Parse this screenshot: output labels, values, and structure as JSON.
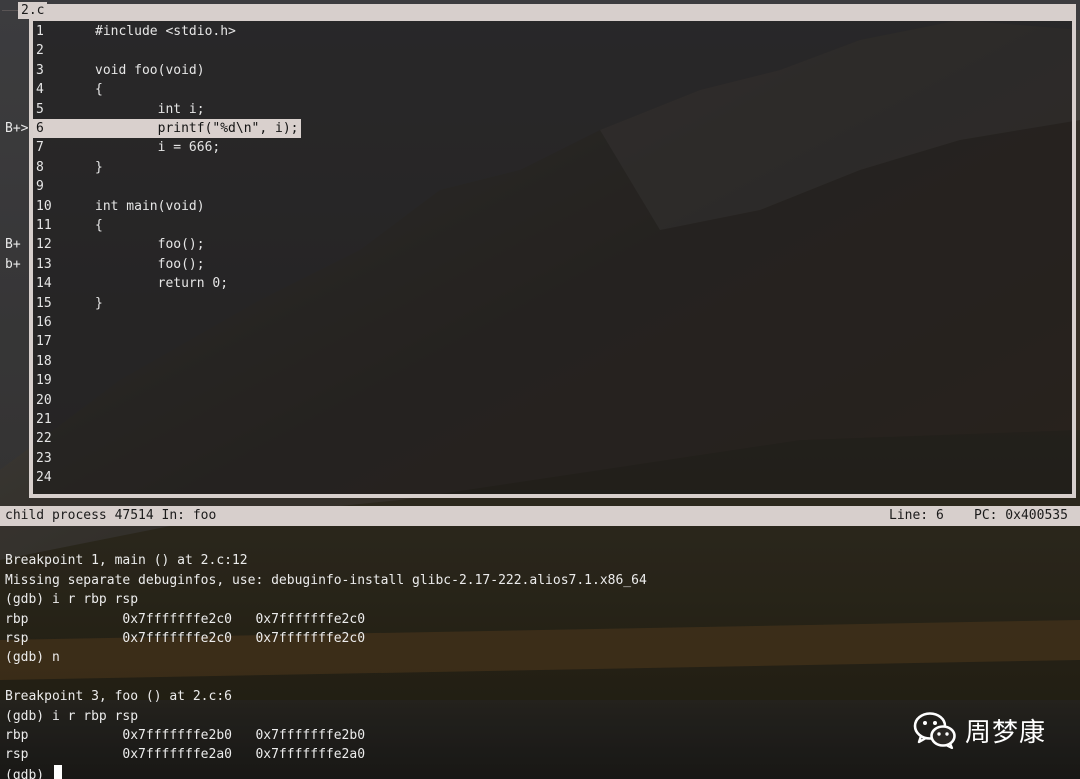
{
  "source_window": {
    "title": "2.c",
    "lines": [
      {
        "num": "1",
        "code": "#include <stdio.h>"
      },
      {
        "num": "2",
        "code": ""
      },
      {
        "num": "3",
        "code": "void foo(void)"
      },
      {
        "num": "4",
        "code": "{"
      },
      {
        "num": "5",
        "code": "        int i;"
      },
      {
        "num": "6",
        "code": "        printf(\"%d\\n\", i);"
      },
      {
        "num": "7",
        "code": "        i = 666;"
      },
      {
        "num": "8",
        "code": "}"
      },
      {
        "num": "9",
        "code": ""
      },
      {
        "num": "10",
        "code": "int main(void)"
      },
      {
        "num": "11",
        "code": "{"
      },
      {
        "num": "12",
        "code": "        foo();"
      },
      {
        "num": "13",
        "code": "        foo();"
      },
      {
        "num": "14",
        "code": "        return 0;"
      },
      {
        "num": "15",
        "code": "}"
      },
      {
        "num": "16",
        "code": ""
      },
      {
        "num": "17",
        "code": ""
      },
      {
        "num": "18",
        "code": ""
      },
      {
        "num": "19",
        "code": ""
      },
      {
        "num": "20",
        "code": ""
      },
      {
        "num": "21",
        "code": ""
      },
      {
        "num": "22",
        "code": ""
      },
      {
        "num": "23",
        "code": ""
      },
      {
        "num": "24",
        "code": ""
      }
    ],
    "current_line": 6,
    "markers": [
      {
        "line": 6,
        "text": "B+>"
      },
      {
        "line": 12,
        "text": "B+"
      },
      {
        "line": 13,
        "text": "b+"
      }
    ]
  },
  "status_bar": {
    "left": "child process 47514 In: foo",
    "line": "Line: 6",
    "pc": "PC: 0x400535"
  },
  "console": {
    "lines": [
      "",
      "Breakpoint 1, main () at 2.c:12",
      "Missing separate debuginfos, use: debuginfo-install glibc-2.17-222.alios7.1.x86_64",
      "(gdb) i r rbp rsp",
      "rbp            0x7fffffffe2c0   0x7fffffffe2c0",
      "rsp            0x7fffffffe2c0   0x7fffffffe2c0",
      "(gdb) n",
      "",
      "Breakpoint 3, foo () at 2.c:6",
      "(gdb) i r rbp rsp",
      "rbp            0x7fffffffe2b0   0x7fffffffe2b0",
      "rsp            0x7fffffffe2a0   0x7fffffffe2a0"
    ],
    "prompt": "(gdb) "
  },
  "watermark": {
    "icon": "wechat-icon",
    "text": "周梦康"
  },
  "colors": {
    "frame": "#d7cfcc",
    "highlight": "#d9d0cd"
  }
}
